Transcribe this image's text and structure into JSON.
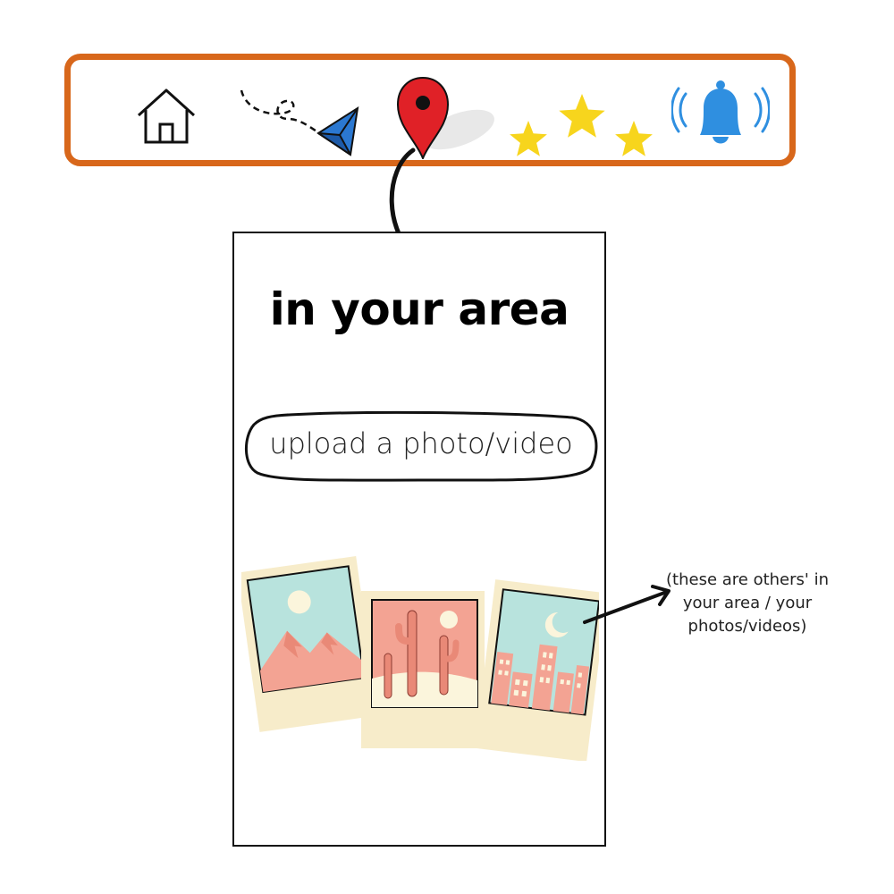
{
  "navbar": {
    "items": [
      {
        "icon": "home-icon"
      },
      {
        "icon": "paper-plane-icon"
      },
      {
        "icon": "location-pin-icon"
      },
      {
        "icon": "stars-icon"
      },
      {
        "icon": "bell-icon"
      }
    ],
    "border_color": "#d8671b"
  },
  "screen": {
    "title": "in your area",
    "upload_label": "upload a photo/video",
    "photos": [
      {
        "icon": "mountain-photo-icon"
      },
      {
        "icon": "cactus-photo-icon"
      },
      {
        "icon": "city-photo-icon"
      }
    ]
  },
  "annotation": {
    "line1": "(these are others' in",
    "line2": "your area / your",
    "line3": "photos/videos)"
  },
  "colors": {
    "pin": "#e02127",
    "star": "#f7d51d",
    "bell": "#2f8fe0",
    "plane": "#2b78d1",
    "frame": "#f7ecca",
    "sky": "#b8e3dd",
    "salmon": "#f3a393"
  }
}
